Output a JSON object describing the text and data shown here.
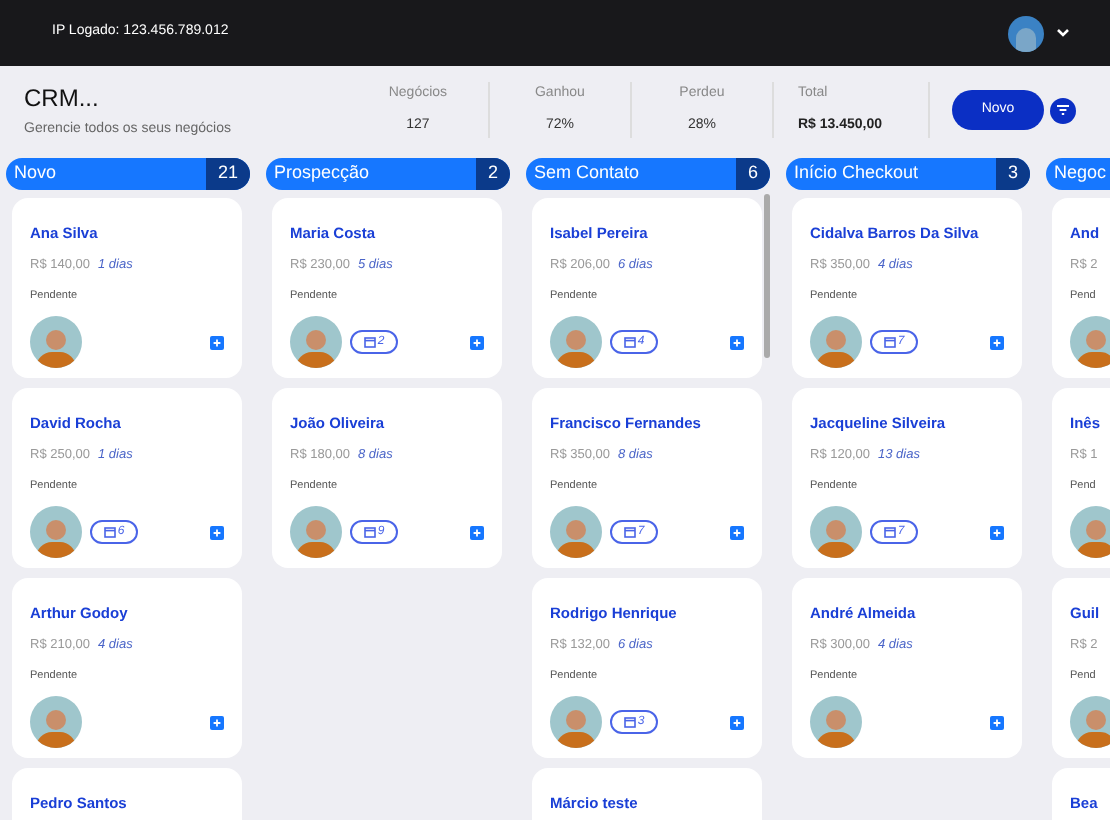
{
  "topbar": {
    "ip_label": "IP Logado: 123.456.789.012"
  },
  "header": {
    "title": "CRM...",
    "subtitle": "Gerencie todos os seus negócios",
    "stats": [
      {
        "label": "Negócios",
        "value": "127"
      },
      {
        "label": "Ganhou",
        "value": "72%"
      },
      {
        "label": "Perdeu",
        "value": "28%"
      },
      {
        "label": "Total",
        "value": "R$ 13.450,00",
        "kind": "total"
      }
    ],
    "new_button": "Novo"
  },
  "columns": [
    {
      "title": "Novo",
      "count": "21",
      "cards": [
        {
          "name": "Ana Silva",
          "value": "R$ 140,00",
          "days": "1 dias",
          "status": "Pendente"
        },
        {
          "name": "David Rocha",
          "value": "R$ 250,00",
          "days": "1 dias",
          "status": "Pendente",
          "badge": "6"
        },
        {
          "name": "Arthur Godoy",
          "value": "R$ 210,00",
          "days": "4 dias",
          "status": "Pendente"
        },
        {
          "name": "Pedro Santos"
        }
      ]
    },
    {
      "title": "Prospecção",
      "count": "2",
      "cards": [
        {
          "name": "Maria Costa",
          "value": "R$ 230,00",
          "days": "5 dias",
          "status": "Pendente",
          "badge": "2"
        },
        {
          "name": "João Oliveira",
          "value": "R$ 180,00",
          "days": "8 dias",
          "status": "Pendente",
          "badge": "9"
        }
      ]
    },
    {
      "title": "Sem Contato",
      "count": "6",
      "scrollbar": true,
      "cards": [
        {
          "name": "Isabel Pereira",
          "value": "R$ 206,00",
          "days": "6 dias",
          "status": "Pendente",
          "badge": "4"
        },
        {
          "name": "Francisco Fernandes",
          "value": "R$ 350,00",
          "days": "8 dias",
          "status": "Pendente",
          "badge": "7"
        },
        {
          "name": "Rodrigo Henrique",
          "value": "R$ 132,00",
          "days": "6 dias",
          "status": "Pendente",
          "badge": "3"
        },
        {
          "name": "Márcio teste"
        }
      ]
    },
    {
      "title": "Início Checkout",
      "count": "3",
      "cards": [
        {
          "name": "Cidalva Barros Da Silva",
          "value": "R$ 350,00",
          "days": "4 dias",
          "status": "Pendente",
          "badge": "7"
        },
        {
          "name": "Jacqueline Silveira",
          "value": "R$ 120,00",
          "days": "13 dias",
          "status": "Pendente",
          "badge": "7"
        },
        {
          "name": "André Almeida",
          "value": "R$ 300,00",
          "days": "4 dias",
          "status": "Pendente"
        }
      ]
    },
    {
      "title": "Negoc",
      "cards": [
        {
          "name": "And",
          "value": "R$ 2",
          "status": "Pend"
        },
        {
          "name": "Inês",
          "value": "R$ 1",
          "status": "Pend"
        },
        {
          "name": "Guil",
          "value": "R$ 2",
          "status": "Pend"
        },
        {
          "name": "Bea"
        }
      ]
    }
  ]
}
